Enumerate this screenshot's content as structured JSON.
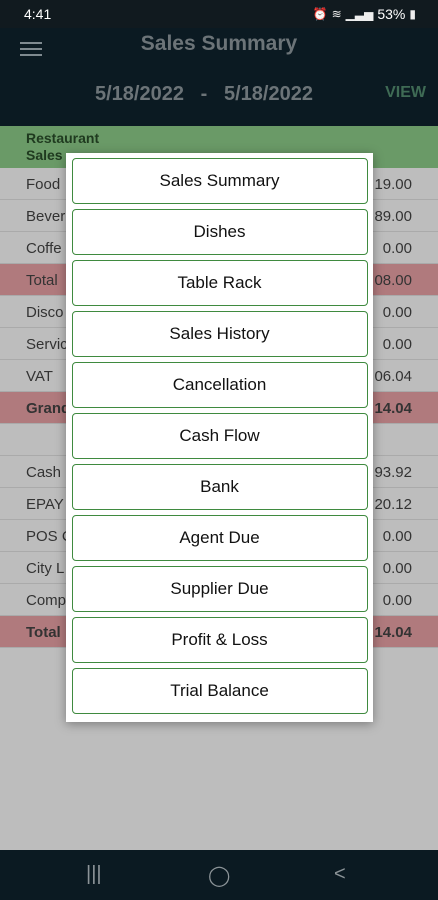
{
  "status": {
    "time": "4:41",
    "battery": "53%"
  },
  "app": {
    "title": "Sales Summary",
    "start_date": "5/18/2022",
    "separator": "-",
    "end_date": "5/18/2022",
    "view_label": "VIEW"
  },
  "table": {
    "header": {
      "line1": "Restaurant",
      "line2": "Sales"
    },
    "rows": [
      {
        "label": "Food",
        "value": "19.00"
      },
      {
        "label": "Bever",
        "value": "89.00"
      },
      {
        "label": "Coffe",
        "value": "0.00"
      },
      {
        "label": "Total",
        "value": "08.00"
      },
      {
        "label": "Disco",
        "value": "0.00"
      },
      {
        "label": "Servic",
        "value": "0.00"
      },
      {
        "label": "VAT",
        "value": "06.04"
      },
      {
        "label": "Grand",
        "value": "14.04"
      },
      {
        "label": "Cash",
        "value": "93.92"
      },
      {
        "label": "EPAY",
        "value": "20.12"
      },
      {
        "label": "POS C",
        "value": "0.00"
      },
      {
        "label": "City L",
        "value": "0.00"
      },
      {
        "label": "Comp",
        "value": "0.00"
      },
      {
        "label": "Total",
        "value": "14.04"
      }
    ]
  },
  "menu": {
    "items": [
      "Sales Summary",
      "Dishes",
      "Table Rack",
      "Sales History",
      "Cancellation",
      "Cash Flow",
      "Bank",
      "Agent Due",
      "Supplier Due",
      "Profit & Loss",
      "Trial Balance"
    ]
  },
  "icons": {
    "menu": "hamburger-icon",
    "alarm": "alarm-icon",
    "wifi": "wifi-icon",
    "signal": "signal-icon",
    "battery": "battery-icon",
    "recents": "recents-icon",
    "home": "home-icon",
    "back": "back-icon"
  },
  "colors": {
    "appbar": "#0b1a22",
    "header_row": "#6a9a67",
    "total_row": "#b07a7d",
    "menu_border": "#3f8a3f"
  }
}
